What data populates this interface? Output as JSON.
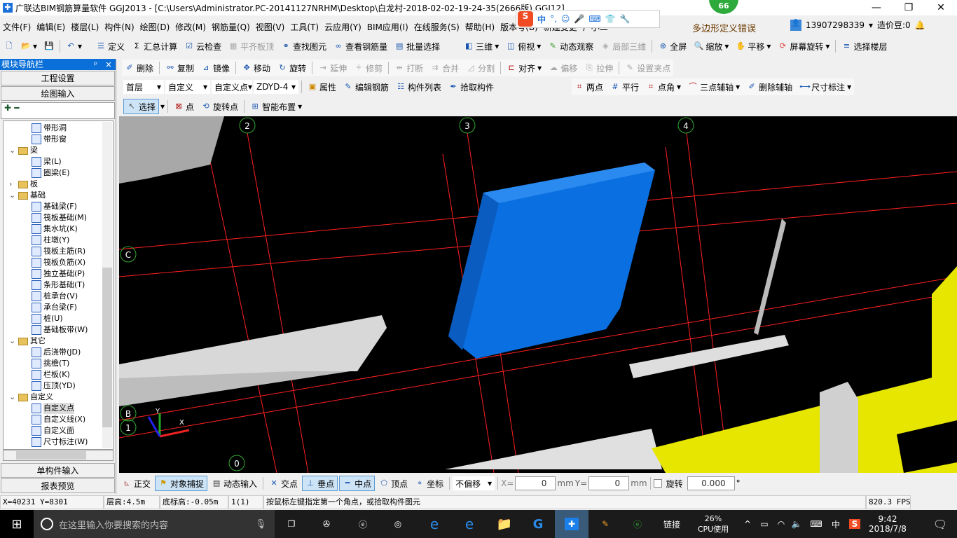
{
  "window": {
    "title": "广联达BIM钢筋算量软件 GGJ2013 - [C:\\Users\\Administrator.PC-20141127NRHM\\Desktop\\白龙村-2018-02-02-19-24-35(2666版).GGJ12]",
    "badge": "66",
    "minimize": "—",
    "restore": "❐",
    "close": "✕"
  },
  "menu": [
    "文件(F)",
    "编辑(E)",
    "楼层(L)",
    "构件(N)",
    "绘图(D)",
    "修改(M)",
    "钢筋量(Q)",
    "视图(V)",
    "工具(T)",
    "云应用(Y)",
    "BIM应用(I)",
    "在线服务(S)",
    "帮助(H)",
    "版本号(B)",
    "新建变更",
    "广小二"
  ],
  "ime": {
    "lang": "中",
    "punct": "°,"
  },
  "alert": "多边形定义错误",
  "user": {
    "phone": "13907298339",
    "beans": "造价豆:0"
  },
  "toolbar1": [
    "定义",
    "汇总计算",
    "云检查",
    "平齐板顶",
    "查找图元",
    "查看钢筋量",
    "批量选择",
    "三维",
    "俯视",
    "动态观察",
    "局部三维",
    "全屏",
    "缩放",
    "平移",
    "屏幕旋转",
    "选择楼层"
  ],
  "toolbar2": [
    "删除",
    "复制",
    "镜像",
    "移动",
    "旋转",
    "延伸",
    "修剪",
    "打断",
    "合并",
    "分割",
    "对齐",
    "偏移",
    "拉伸",
    "设置夹点"
  ],
  "toolbar3": {
    "floor": "首层",
    "type": "自定义",
    "sub": "自定义点",
    "name": "ZDYD-4",
    "buttons": [
      "属性",
      "编辑钢筋",
      "构件列表",
      "拾取构件"
    ],
    "axis": [
      "两点",
      "平行",
      "点角",
      "三点辅轴",
      "删除辅轴",
      "尺寸标注"
    ]
  },
  "toolbar4": [
    "选择",
    "点",
    "旋转点",
    "智能布置"
  ],
  "sidebar": {
    "title": "模块导航栏",
    "pin": "ᵖ",
    "close": "×",
    "top": [
      "工程设置",
      "绘图输入"
    ],
    "bottom": [
      "单构件输入",
      "报表预览"
    ],
    "tree": [
      {
        "label": "带形洞",
        "level": 2
      },
      {
        "label": "带形窗",
        "level": 2
      },
      {
        "label": "梁",
        "level": 1,
        "folder": true,
        "open": true
      },
      {
        "label": "梁(L)",
        "level": 2
      },
      {
        "label": "圈梁(E)",
        "level": 2
      },
      {
        "label": "板",
        "level": 1,
        "folder": true,
        "open": false
      },
      {
        "label": "基础",
        "level": 1,
        "folder": true,
        "open": true
      },
      {
        "label": "基础梁(F)",
        "level": 2
      },
      {
        "label": "筏板基础(M)",
        "level": 2
      },
      {
        "label": "集水坑(K)",
        "level": 2
      },
      {
        "label": "柱墩(Y)",
        "level": 2
      },
      {
        "label": "筏板主筋(R)",
        "level": 2
      },
      {
        "label": "筏板负筋(X)",
        "level": 2
      },
      {
        "label": "独立基础(P)",
        "level": 2
      },
      {
        "label": "条形基础(T)",
        "level": 2
      },
      {
        "label": "桩承台(V)",
        "level": 2
      },
      {
        "label": "承台梁(F)",
        "level": 2
      },
      {
        "label": "桩(U)",
        "level": 2
      },
      {
        "label": "基础板带(W)",
        "level": 2
      },
      {
        "label": "其它",
        "level": 1,
        "folder": true,
        "open": true
      },
      {
        "label": "后浇带(JD)",
        "level": 2
      },
      {
        "label": "挑檐(T)",
        "level": 2
      },
      {
        "label": "栏板(K)",
        "level": 2
      },
      {
        "label": "压顶(YD)",
        "level": 2
      },
      {
        "label": "自定义",
        "level": 1,
        "folder": true,
        "open": true
      },
      {
        "label": "自定义点",
        "level": 2,
        "selected": true
      },
      {
        "label": "自定义线(X)",
        "level": 2
      },
      {
        "label": "自定义面",
        "level": 2
      },
      {
        "label": "尺寸标注(W)",
        "level": 2
      }
    ]
  },
  "viewport": {
    "axes": [
      "2",
      "3",
      "4",
      "C",
      "B",
      "1",
      "0"
    ],
    "coord_axes": [
      "Y",
      "X"
    ],
    "colors": {
      "block": "#0a6fe0",
      "grid": "#ff0000",
      "beam": "#d8d8d8",
      "structure": "#e6e600"
    }
  },
  "bottombar": {
    "buttons": [
      "正交",
      "对象捕捉",
      "动态输入",
      "交点",
      "垂点",
      "中点",
      "顶点",
      "坐标"
    ],
    "offset": "不偏移",
    "x_label": "X=",
    "x": "0",
    "y_label": "Y=",
    "y": "0",
    "unit": "mm",
    "rotate_label": "旋转",
    "rotate": "0.000",
    "deg": "°"
  },
  "status": {
    "coords": "X=40231 Y=8301",
    "floor_height": "层高:4.5m",
    "bottom_height": "底标高:-0.05m",
    "count": "1(1)",
    "hint": "按鼠标左键指定第一个角点，或拾取构件图元",
    "fps": "820.3 FPS"
  },
  "taskbar": {
    "search": "在这里输入你要搜索的内容",
    "links": "链接",
    "cpu": "26%",
    "cpu_label": "CPU使用",
    "ime": "中",
    "time": "9:42",
    "date": "2018/7/8"
  }
}
